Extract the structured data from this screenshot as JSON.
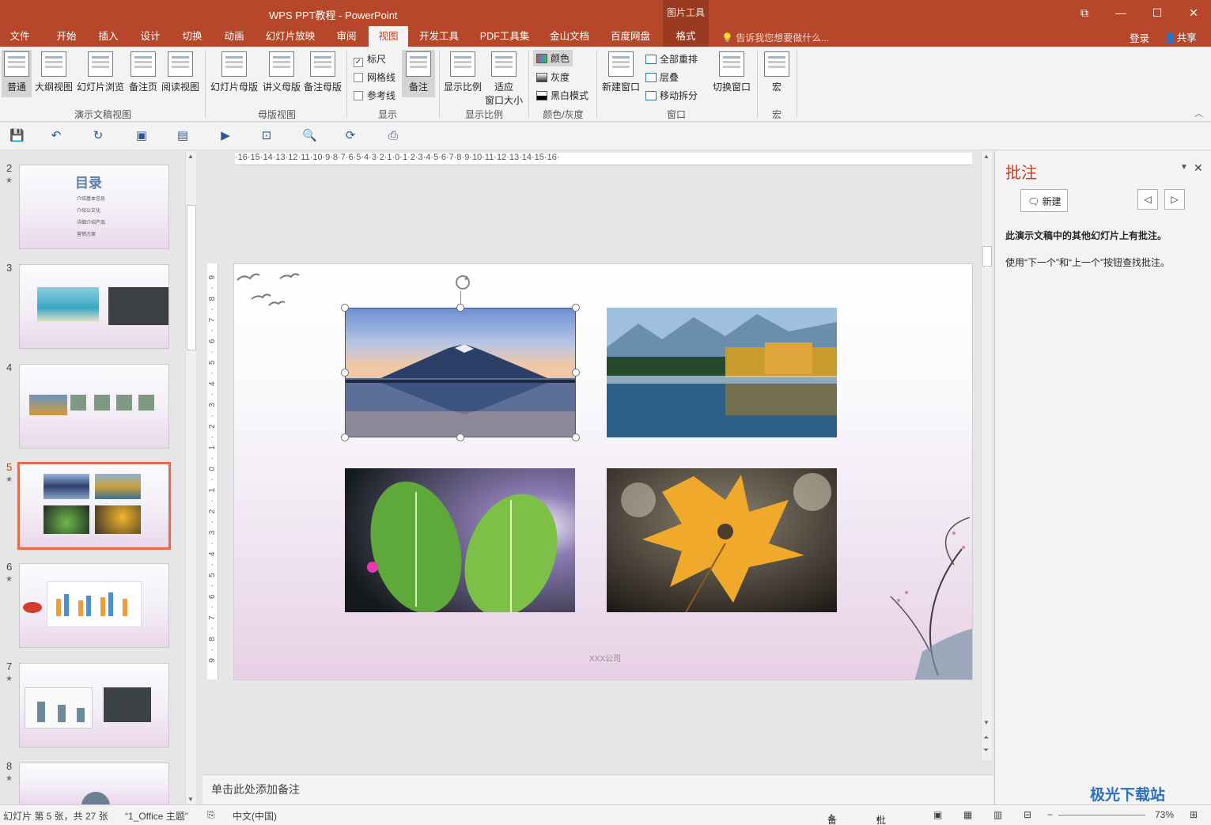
{
  "window": {
    "title": "WPS PPT教程 - PowerPoint",
    "context_tab_group": "图片工具",
    "controls": [
      "⧉",
      "—",
      "☐",
      "✕"
    ]
  },
  "tabs": [
    "文件",
    "开始",
    "插入",
    "设计",
    "切换",
    "动画",
    "幻灯片放映",
    "审阅",
    "视图",
    "开发工具",
    "PDF工具集",
    "金山文档",
    "百度网盘",
    "格式"
  ],
  "active_tab": "视图",
  "tellme": "告诉我您想要做什么...",
  "login": "登录",
  "share": "共享",
  "ribbon": {
    "views": [
      "普通",
      "大纲视图",
      "幻灯片浏览",
      "备注页",
      "阅读视图"
    ],
    "views_group": "演示文稿视图",
    "masters": [
      "幻灯片母版",
      "讲义母版",
      "备注母版"
    ],
    "masters_group": "母版视图",
    "show": {
      "ruler": "标尺",
      "gridlines": "网格线",
      "guides": "参考线",
      "notes": "备注",
      "group": "显示"
    },
    "zoom": {
      "zoom": "显示比例",
      "fit_line1": "适应",
      "fit_line2": "窗口大小",
      "group": "显示比例"
    },
    "color": {
      "color": "颜色",
      "gray": "灰度",
      "bw": "黑白模式",
      "group": "颜色/灰度"
    },
    "window": {
      "new": "新建窗口",
      "arrange": "全部重排",
      "cascade": "层叠",
      "split": "移动拆分",
      "switch": "切换窗口",
      "group": "窗口"
    },
    "macro": {
      "macro": "宏",
      "group": "宏"
    }
  },
  "thumbnails": [
    {
      "num": "2",
      "title": "目录",
      "items": [
        "介绍基本信息",
        "介绍公文化",
        "详细介绍产品",
        "营销方案"
      ]
    },
    {
      "num": "3"
    },
    {
      "num": "4"
    },
    {
      "num": "5"
    },
    {
      "num": "6"
    },
    {
      "num": "7"
    },
    {
      "num": "8"
    }
  ],
  "slide": {
    "footer": "XXX公司"
  },
  "ruler_h": "·16·15·14·13·12·11·10·9·8·7·6·5·4·3·2·1·0·1·2·3·4·5·6·7·8·9·10·11·12·13·14·15·16·",
  "ruler_v": "9·8·7·6·5·4·3·2·1·0·1·2·3·4·5·6·7·8·9",
  "notes_placeholder": "单击此处添加备注",
  "comments_pane": {
    "title": "批注",
    "new_button": "新建",
    "message_bold": "此演示文稿中的其他幻灯片上有批注。",
    "message": "使用“下一个”和“上一个”按钮查找批注。"
  },
  "status": {
    "slide_info": "幻灯片 第 5 张，共 27 张",
    "theme": "“1_Office 主题”",
    "language": "中文(中国)",
    "notes": "备注",
    "comments": "批注",
    "zoom": "73%"
  },
  "watermark": "极光下载站"
}
